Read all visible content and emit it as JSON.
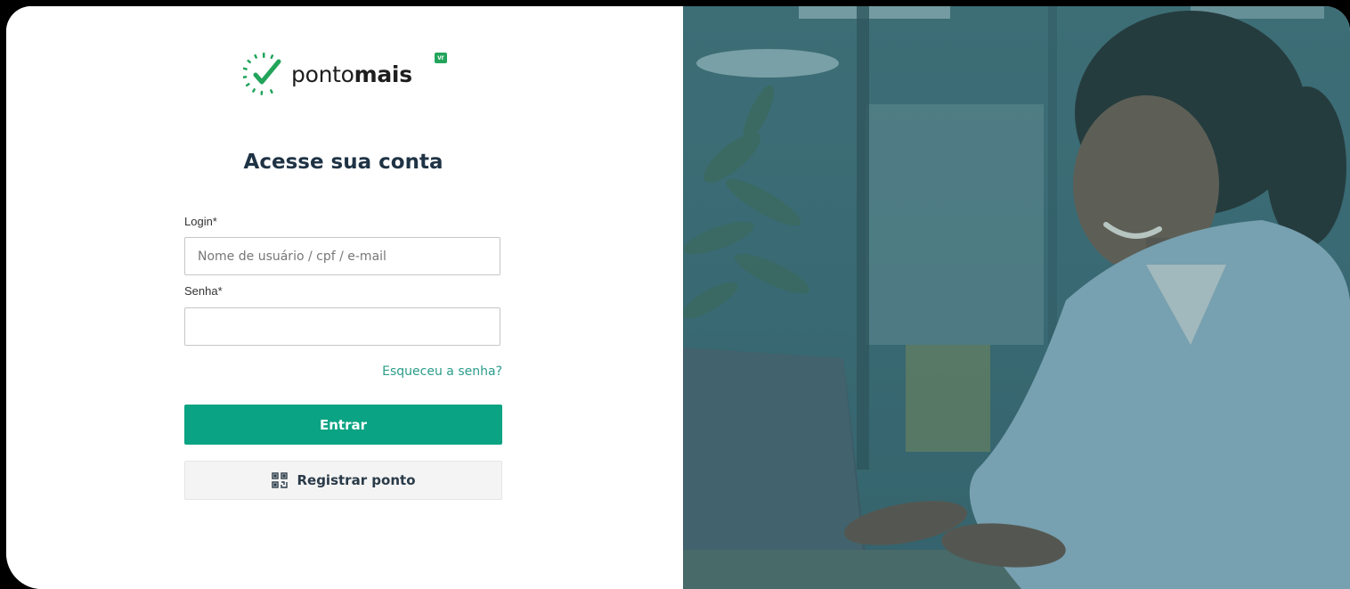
{
  "brand": {
    "name_regular": "ponto",
    "name_bold": "mais",
    "badge": "vr",
    "accent_color": "#0aa383",
    "logo_check_color": "#22a45b"
  },
  "login": {
    "title": "Acesse sua conta",
    "login_label": "Login*",
    "login_placeholder": "Nome de usuário / cpf / e-mail",
    "login_value": "",
    "password_label": "Senha*",
    "password_value": "",
    "forgot_link": "Esqueceu a senha?",
    "submit_button": "Entrar",
    "register_button": "Registrar ponto",
    "register_icon": "qr-code-icon"
  },
  "hero": {
    "image_subject": "woman-smiling-at-laptop-photo",
    "overlay_color": "#3b6a74"
  }
}
